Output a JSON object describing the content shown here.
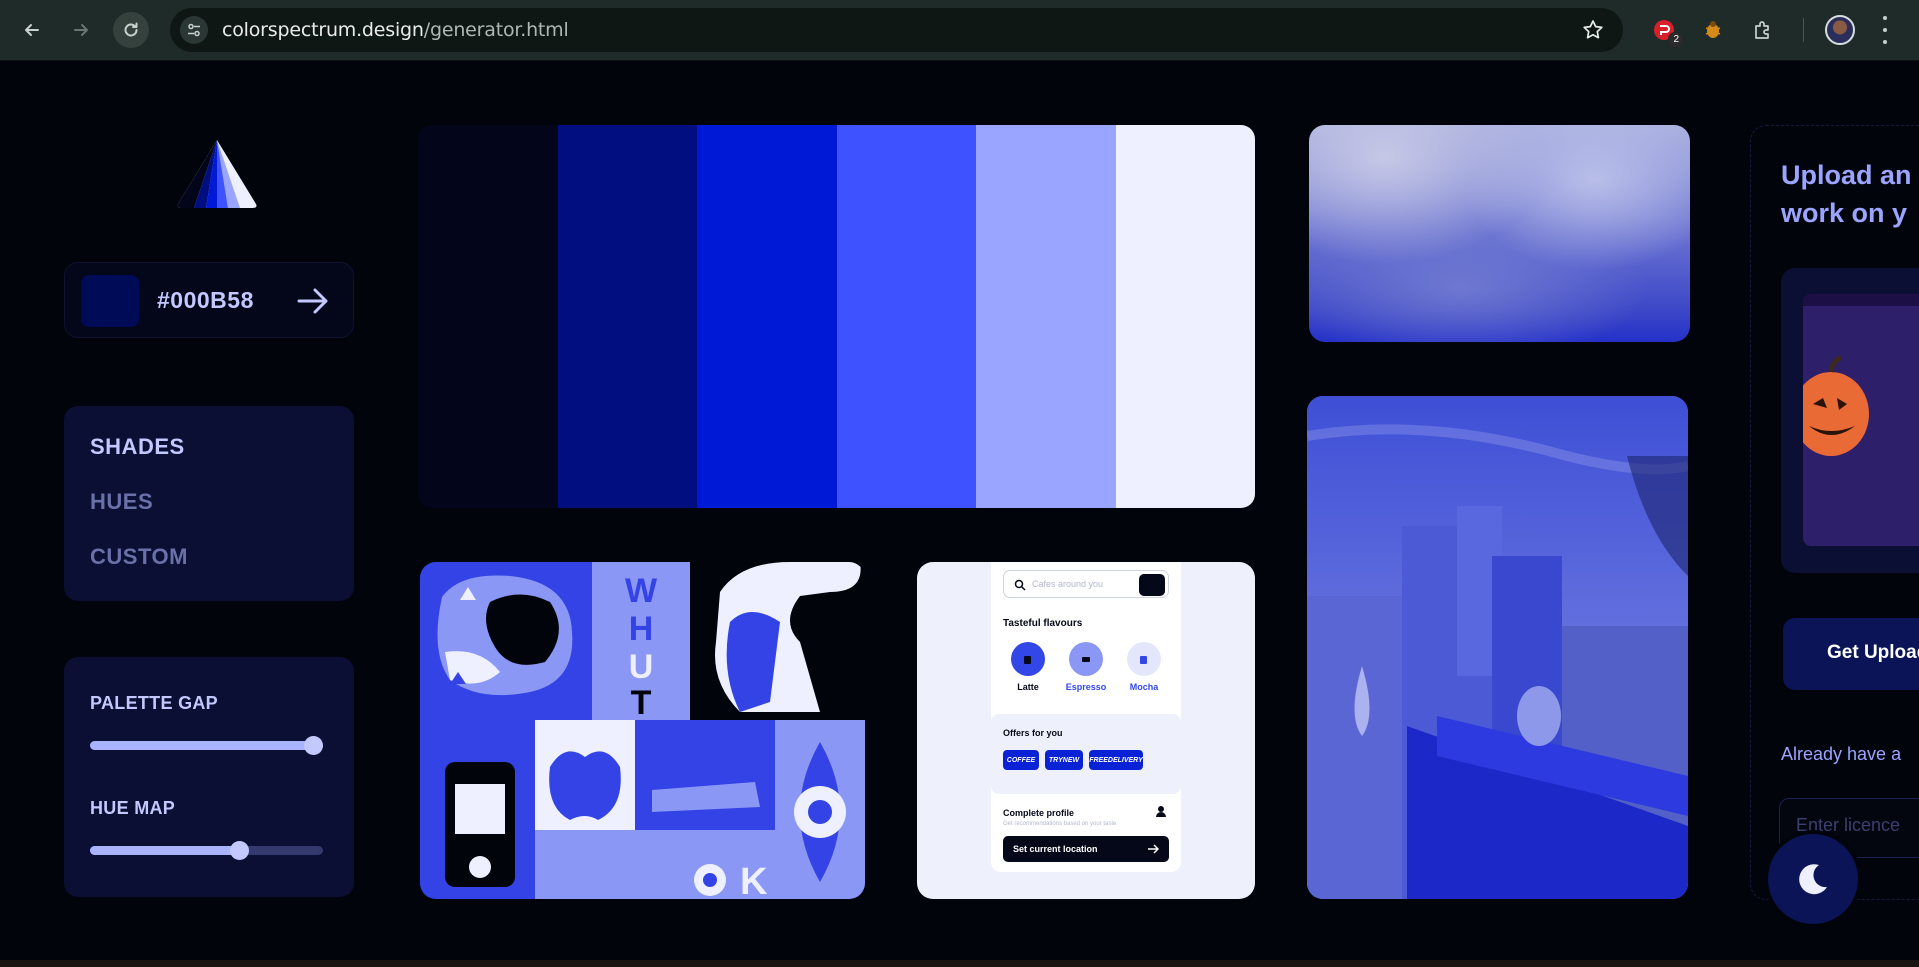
{
  "browser": {
    "url_host": "colorspectrum.design",
    "url_path": "/generator.html",
    "extension_badge": "2"
  },
  "sidebar": {
    "hex_value": "#000B58",
    "modes": [
      {
        "label": "SHADES",
        "active": true
      },
      {
        "label": "HUES",
        "active": false
      },
      {
        "label": "CUSTOM",
        "active": false
      }
    ],
    "sliders": [
      {
        "label": "PALETTE GAP",
        "value": 1.0
      },
      {
        "label": "HUE MAP",
        "value": 0.64
      }
    ]
  },
  "palette": {
    "colors": [
      "#03061a",
      "#000e80",
      "#0019d6",
      "#3f52ff",
      "#9aa5ff",
      "#eef0ff"
    ]
  },
  "app_mock": {
    "search_placeholder": "Cafes around you",
    "section_title": "Tasteful flavours",
    "drinks": [
      {
        "label": "Latte",
        "color": "#3347e8"
      },
      {
        "label": "Espresso",
        "color": "#8b97f5"
      },
      {
        "label": "Mocha",
        "color": "#e4e7fb"
      }
    ],
    "offers_title": "Offers for you",
    "offer_codes": [
      "COFFEE",
      "TRYNEW",
      "FREEDELIVERY"
    ],
    "profile_title": "Complete profile",
    "profile_subtitle": "Get recommendations based on your taste",
    "location_button": "Set current location"
  },
  "right_panel": {
    "title_line1": "Upload an",
    "title_line2": "work on y",
    "cta_button": "Get Upload",
    "already_text": "Already have a",
    "license_placeholder": "Enter licence"
  },
  "colors": {
    "accent": "#000B58",
    "light_accent": "#c3c8ff",
    "background": "#02040c"
  }
}
